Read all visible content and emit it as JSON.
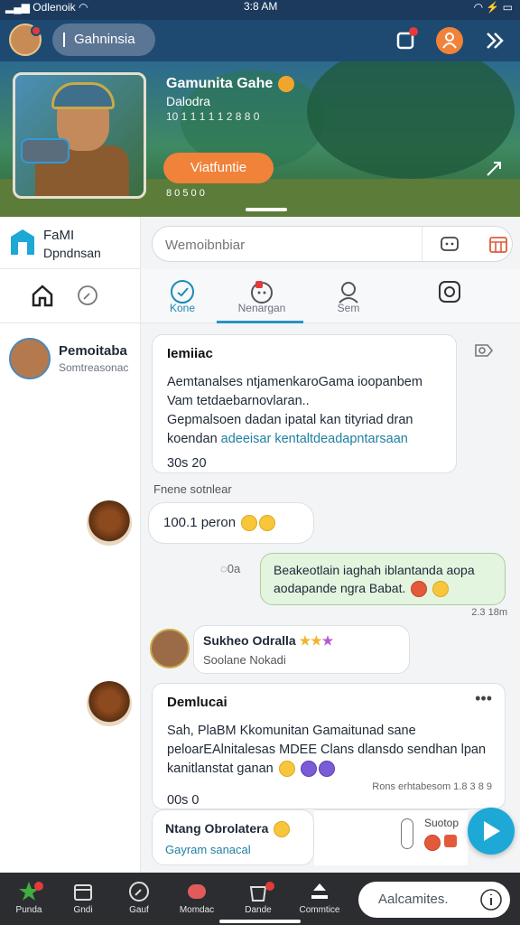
{
  "status_bar": {
    "carrier": "Odlenoik",
    "time": "3:8 AM"
  },
  "top_bar": {
    "community_label": "Gahninsia"
  },
  "hero": {
    "title": "Gamunita Gahe",
    "subtitle": "Dalodra",
    "meta": "10 1 1 1 1 1 2 8 8 0",
    "button_label": "Viatfuntie",
    "footer": "8 0 5  0 0"
  },
  "sidebar": {
    "brand_name": "FaMI",
    "brand_sub": "Dpndnsan",
    "friend_name": "Pemoitaba",
    "friend_status": "Somtreasonac"
  },
  "search": {
    "placeholder": "Wemoibnbiar"
  },
  "tabs": [
    {
      "label": "Kone"
    },
    {
      "label": "Nenargan"
    },
    {
      "label": "Sem"
    },
    {
      "label": ""
    }
  ],
  "post1": {
    "header": "Iemiiac",
    "line1": "Aemtanalses ntjamenkaroGama ioopanbem",
    "line2": "Vam tetdaebarnovlaran..",
    "line3": "Gepmalsoen dadan ipatal kan tityriad dran",
    "line4_plain": "koendan ",
    "line4_teal": "adeeisar kentaltdeadapntarsaan",
    "time": "30s 20"
  },
  "reply_label": "Fnene sotnlear",
  "bubble1": {
    "text": "100.1 peron"
  },
  "green_message": {
    "line1": "Beakeotlain iaghah iblantanda aopa",
    "line2": "aodapande ngra Babat.",
    "time": "2.3 18m",
    "meta_icon_label": "0a"
  },
  "user_row": {
    "name": "Sukheo Odralla",
    "sub": "Soolane Nokadi"
  },
  "post2": {
    "header": "Demlucai",
    "line1": "Sah, PlaBM Kkomunitan Gamaitunad sane",
    "line2": "peloarEAlnitalesas MDEE Clans dlansdo sendhan lpan",
    "line3": "kanitlanstat ganan",
    "meta": "Rons erhtabesom 1.8 3 8 9",
    "time": "00s  0"
  },
  "compose": {
    "name": "Ntang Obrolatera",
    "sub": "Gayram sanacal",
    "side": "Suotop"
  },
  "bottom_nav": [
    {
      "label": "Punda"
    },
    {
      "label": "Gndi"
    },
    {
      "label": "Gauf"
    },
    {
      "label": "Momdac"
    },
    {
      "label": "Dande"
    },
    {
      "label": "Commtice"
    }
  ],
  "bottom_search": {
    "placeholder": "Aalcamites."
  },
  "colors": {
    "accent": "#1da8d6",
    "header": "#1e4a72",
    "button": "#f1823a",
    "green_bubble": "#e3f4df"
  }
}
